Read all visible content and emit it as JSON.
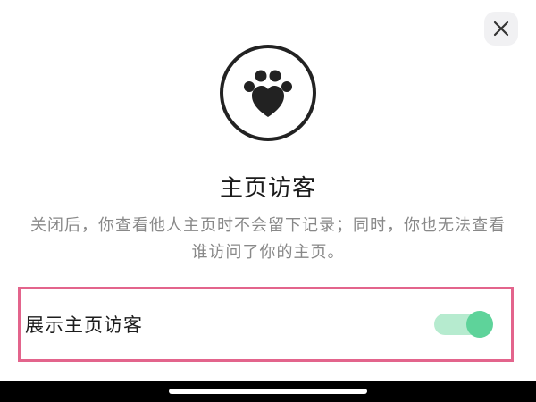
{
  "sheet": {
    "close_icon": "close-icon",
    "badge_icon": "paw-heart-icon",
    "title": "主页访客",
    "description": "关闭后，你查看他人主页时不会留下记录；同时，你也无法查看谁访问了你的主页。"
  },
  "setting": {
    "label": "展示主页访客",
    "toggle_on": true,
    "toggle_color": "#5ed39a",
    "highlight_color": "#e3648c"
  }
}
